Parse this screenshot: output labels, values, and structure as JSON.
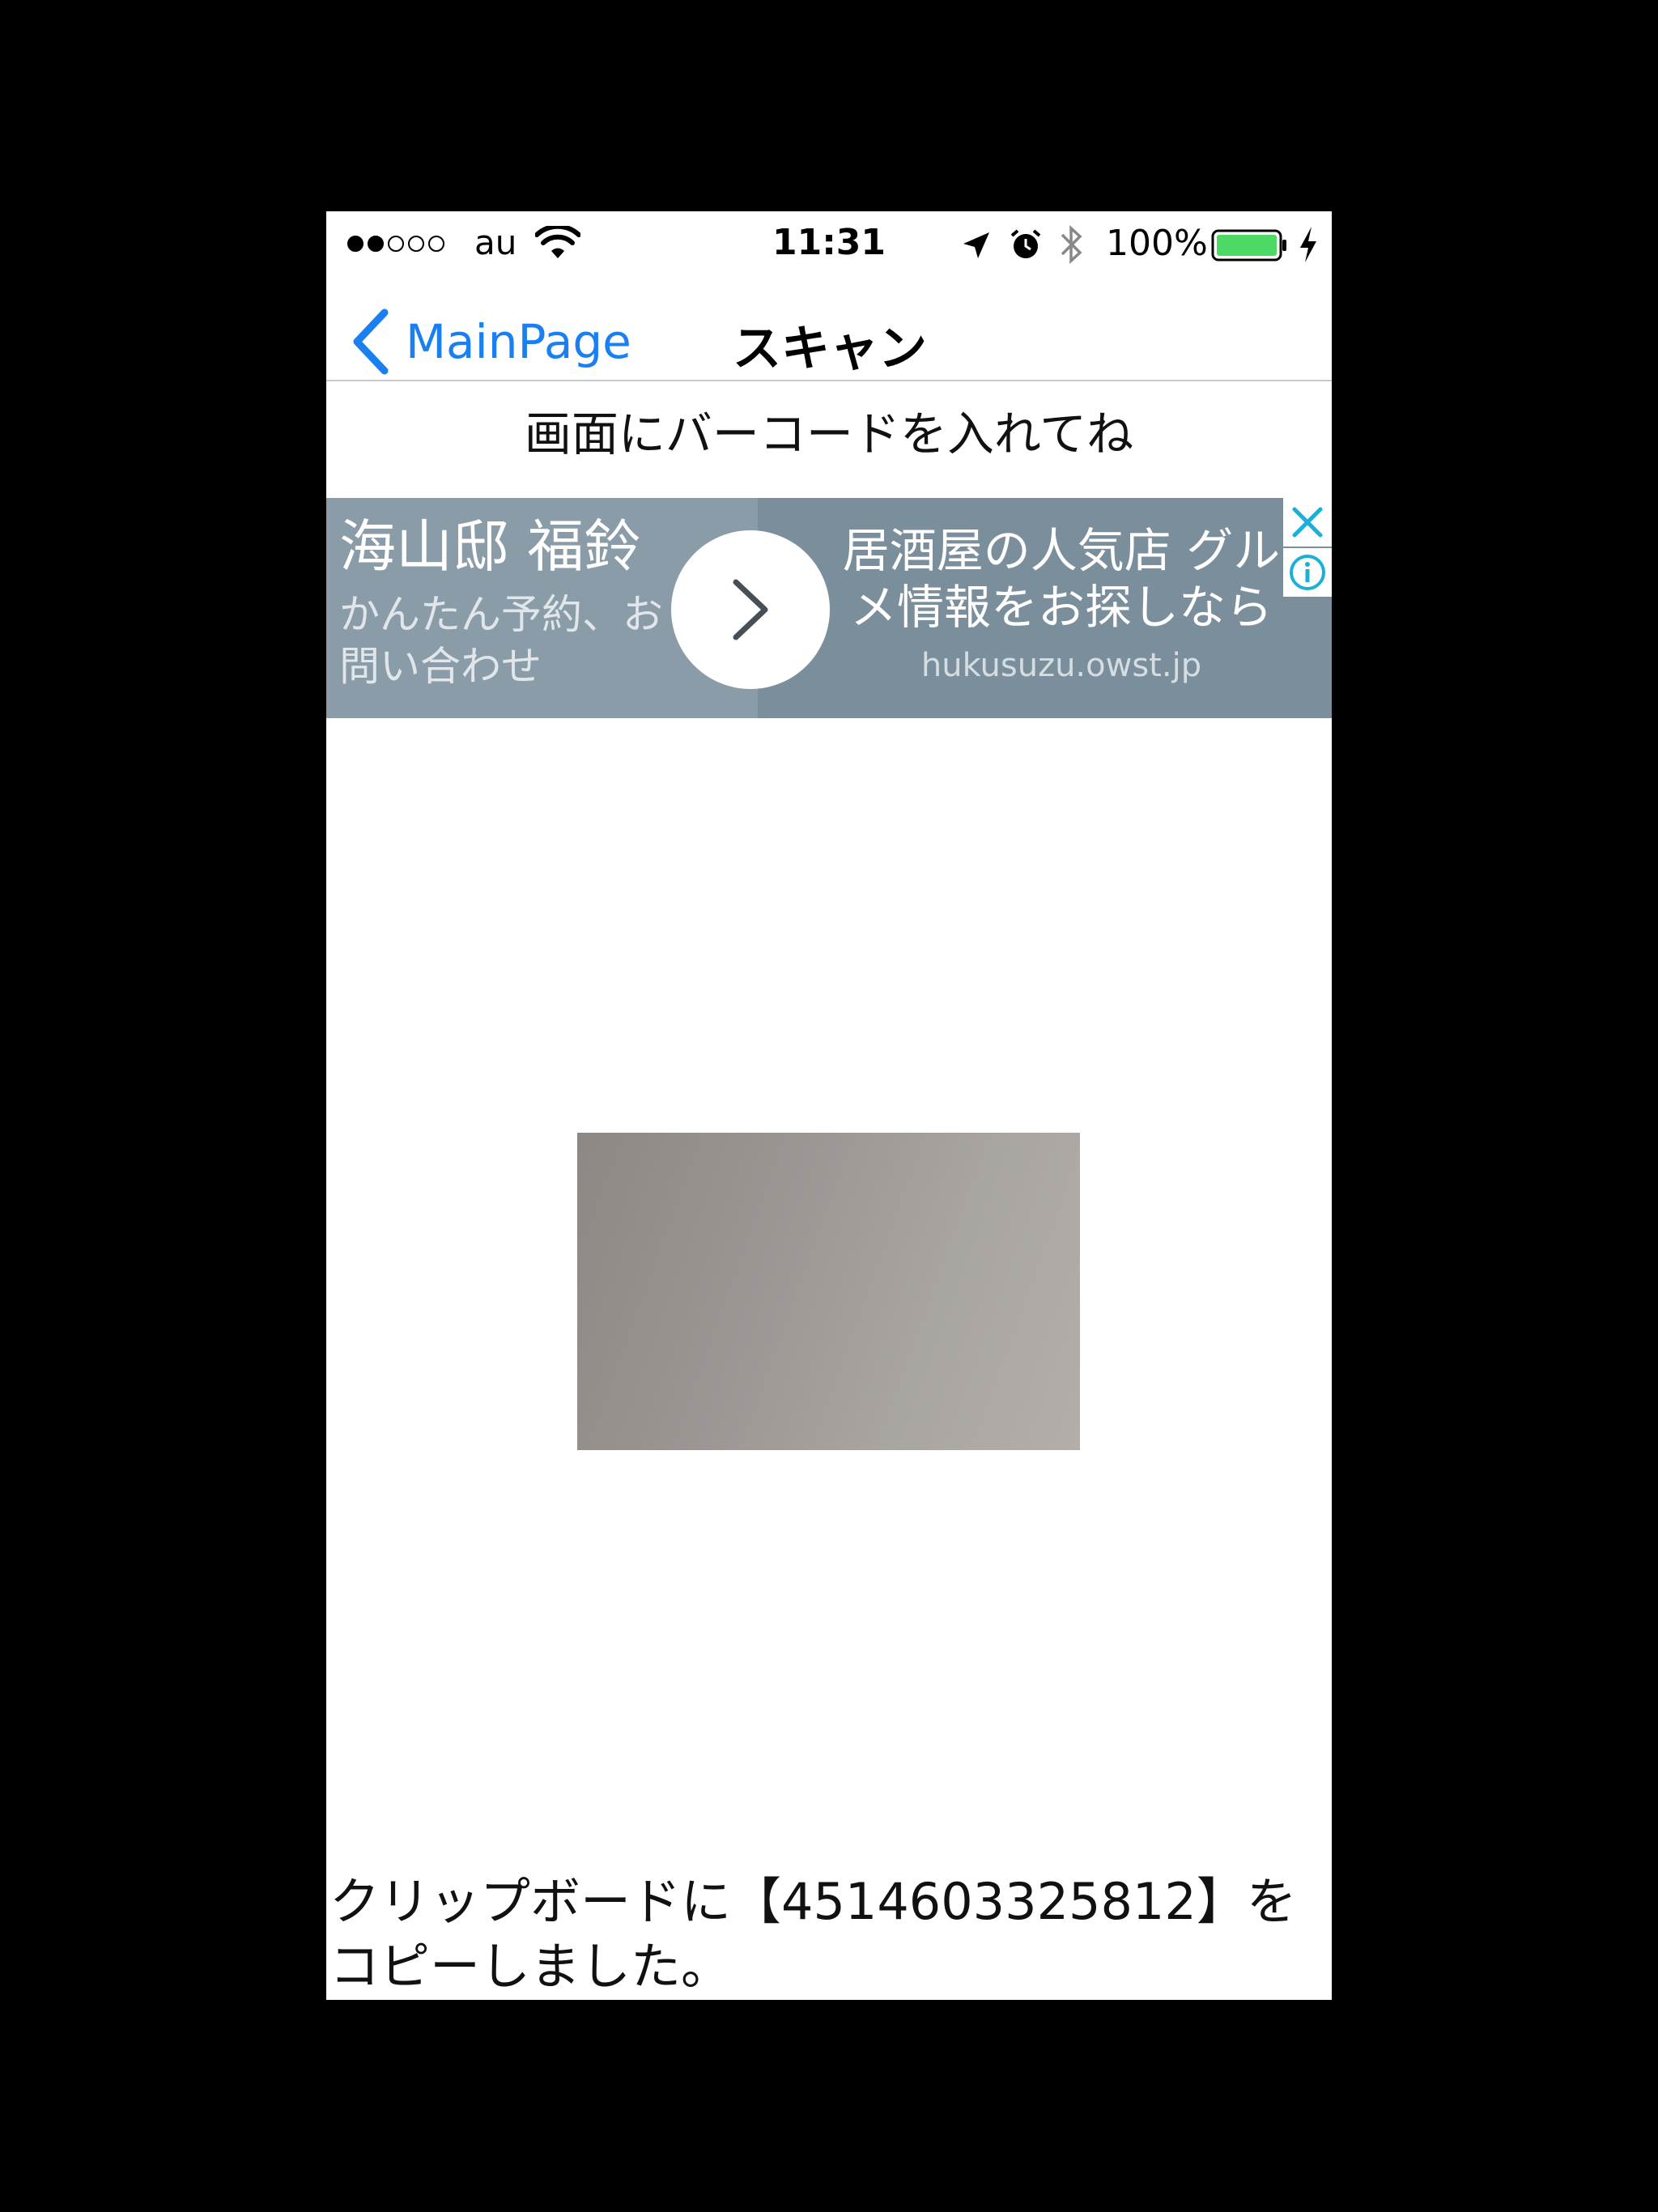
{
  "status_bar": {
    "carrier": "au",
    "time": "11:31",
    "battery_percent": "100%",
    "signal_bars_filled": 2,
    "signal_bars_total": 5,
    "icons": [
      "wifi-icon",
      "location-arrow-icon",
      "alarm-icon",
      "bluetooth-icon",
      "battery-icon",
      "charging-bolt-icon"
    ],
    "battery_color": "#4cd964"
  },
  "nav": {
    "back_label": "MainPage",
    "title": "スキャン",
    "accent_color": "#1a7ff0"
  },
  "instruction": "画面にバーコードを入れてね",
  "ad": {
    "name": "海山邸 福鈴",
    "sub": "かんたん予約、お問い合わせ",
    "headline": "居酒屋の人気店 グルメ情報をお探しなら",
    "url": "hukusuzu.owst.jp",
    "icons": [
      "chevron-right-icon",
      "close-icon",
      "info-icon"
    ]
  },
  "result": "クリップボードに【4514603325812】をコピーしました。"
}
